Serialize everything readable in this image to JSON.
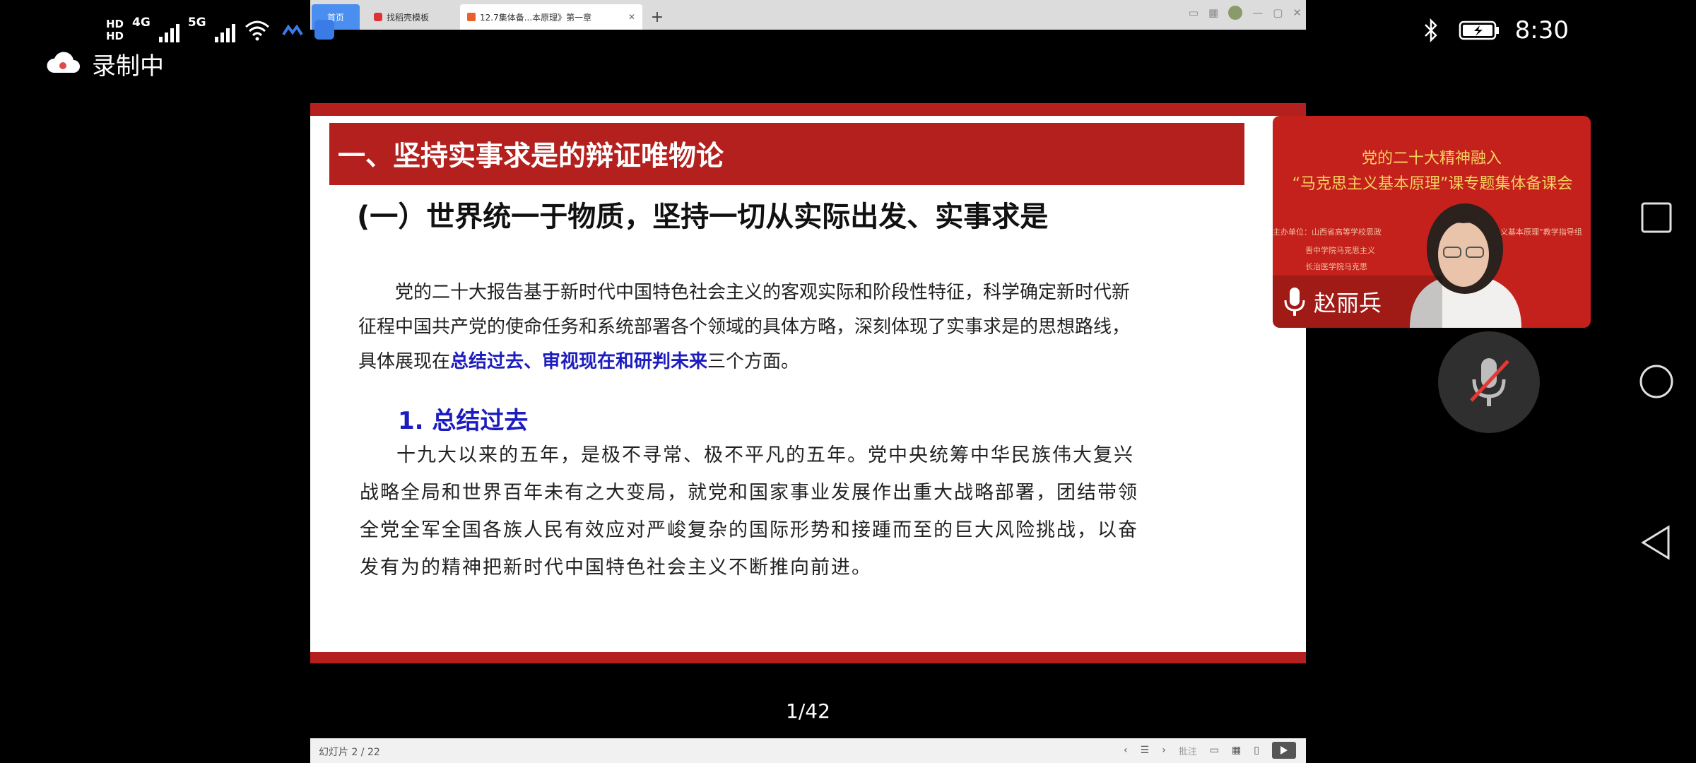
{
  "status_bar": {
    "sim1_label": "HD",
    "sim1_type": "4G",
    "sim2_label": "HD",
    "sim2_type": "5G",
    "time": "8:30",
    "icons": [
      "wifi-icon",
      "app-icon",
      "hand-icon",
      "bluetooth-icon",
      "battery-charging-icon"
    ]
  },
  "recording": {
    "label": "录制中"
  },
  "browser": {
    "tabs": [
      {
        "label": "首页"
      },
      {
        "label": "找稻壳模板"
      },
      {
        "label": "12.7集体备...本原理》第一章"
      }
    ],
    "new_tab_label": "+"
  },
  "slide": {
    "title": "一、坚持实事求是的辩证唯物论",
    "subtitle": "(一）世界统一于物质，坚持一切从实际出发、实事求是",
    "paragraph1_line1": "党的二十大报告基于新时代中国特色社会主义的客观实际和阶段性特征，科学确定新时代新",
    "paragraph1_line2": "征程中国共产党的使命任务和系统部署各个领域的具体方略，深刻体现了实事求是的思想路线，",
    "paragraph1_line3_start": "具体展现在",
    "paragraph1_highlight": "总结过去、审视现在和研判未来",
    "paragraph1_line3_end": "三个方面。",
    "section_heading": "1. 总结过去",
    "paragraph2_line1": "十九大以来的五年，是极不寻常、极不平凡的五年。党中央统筹中华民族伟大复兴",
    "paragraph2_line2": "战略全局和世界百年未有之大变局，就党和国家事业发展作出重大战略部署，团结带领",
    "paragraph2_line3": "全党全军全国各族人民有效应对严峻复杂的国际形势和接踵而至的巨大风险挑战，以奋",
    "paragraph2_line4": "发有为的精神把新时代中国特色社会主义不断推向前进。"
  },
  "page_counter": "1/42",
  "ppt_status": {
    "slide_no": "幻灯片 2 / 22",
    "notes_label": "批注"
  },
  "speaker": {
    "banner_line1": "党的二十大精神融入",
    "banner_line2": "“马克思主义基本原理”课专题集体备课会",
    "small_line1": "主办单位：山西省高等学校思政",
    "small_line2": "晋中学院马克思主义",
    "small_line3": "长治医学院马克思",
    "small_right": "思主义基本原理”教学指导组",
    "name": "赵丽兵"
  },
  "colors": {
    "slide_red": "#b3201d",
    "highlight_blue": "#1d1dbf",
    "banner_gold": "#f4d35e"
  }
}
